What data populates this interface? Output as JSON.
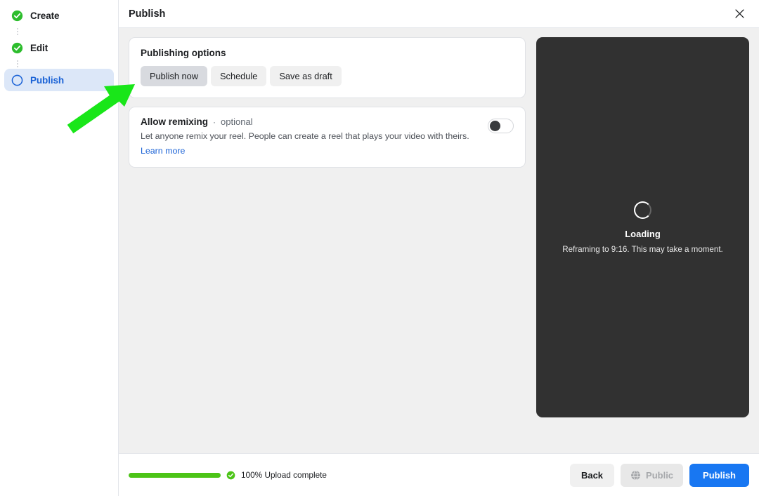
{
  "sidebar": {
    "steps": [
      {
        "label": "Create",
        "icon": "check-circle-icon",
        "state": "done"
      },
      {
        "label": "Edit",
        "icon": "check-circle-icon",
        "state": "done"
      },
      {
        "label": "Publish",
        "icon": "circle-outline-icon",
        "state": "active"
      }
    ]
  },
  "titlebar": {
    "title": "Publish",
    "close_icon": "close-icon"
  },
  "publishing_options": {
    "title": "Publishing options",
    "buttons": [
      {
        "label": "Publish now",
        "selected": true
      },
      {
        "label": "Schedule",
        "selected": false
      },
      {
        "label": "Save as draft",
        "selected": false
      }
    ]
  },
  "allow_remixing": {
    "title": "Allow remixing",
    "separator": "·",
    "optional_label": "optional",
    "description": "Let anyone remix your reel. People can create a reel that plays your video with theirs.",
    "learn_more": "Learn more",
    "toggle_state": "off"
  },
  "preview": {
    "loading_title": "Loading",
    "loading_subtitle": "Reframing to 9:16. This may take a moment.",
    "spinner_icon": "spinner-icon",
    "background_color": "#313131"
  },
  "footer": {
    "progress_percent": 100,
    "progress_text": "100% Upload complete",
    "progress_color": "#4cc417",
    "check_icon": "check-circle-icon",
    "back_label": "Back",
    "public_label": "Public",
    "public_icon": "globe-icon",
    "publish_label": "Publish",
    "publish_color": "#1877f2"
  },
  "annotation": {
    "arrow_color": "#19e619",
    "points_to": "Publish now"
  }
}
